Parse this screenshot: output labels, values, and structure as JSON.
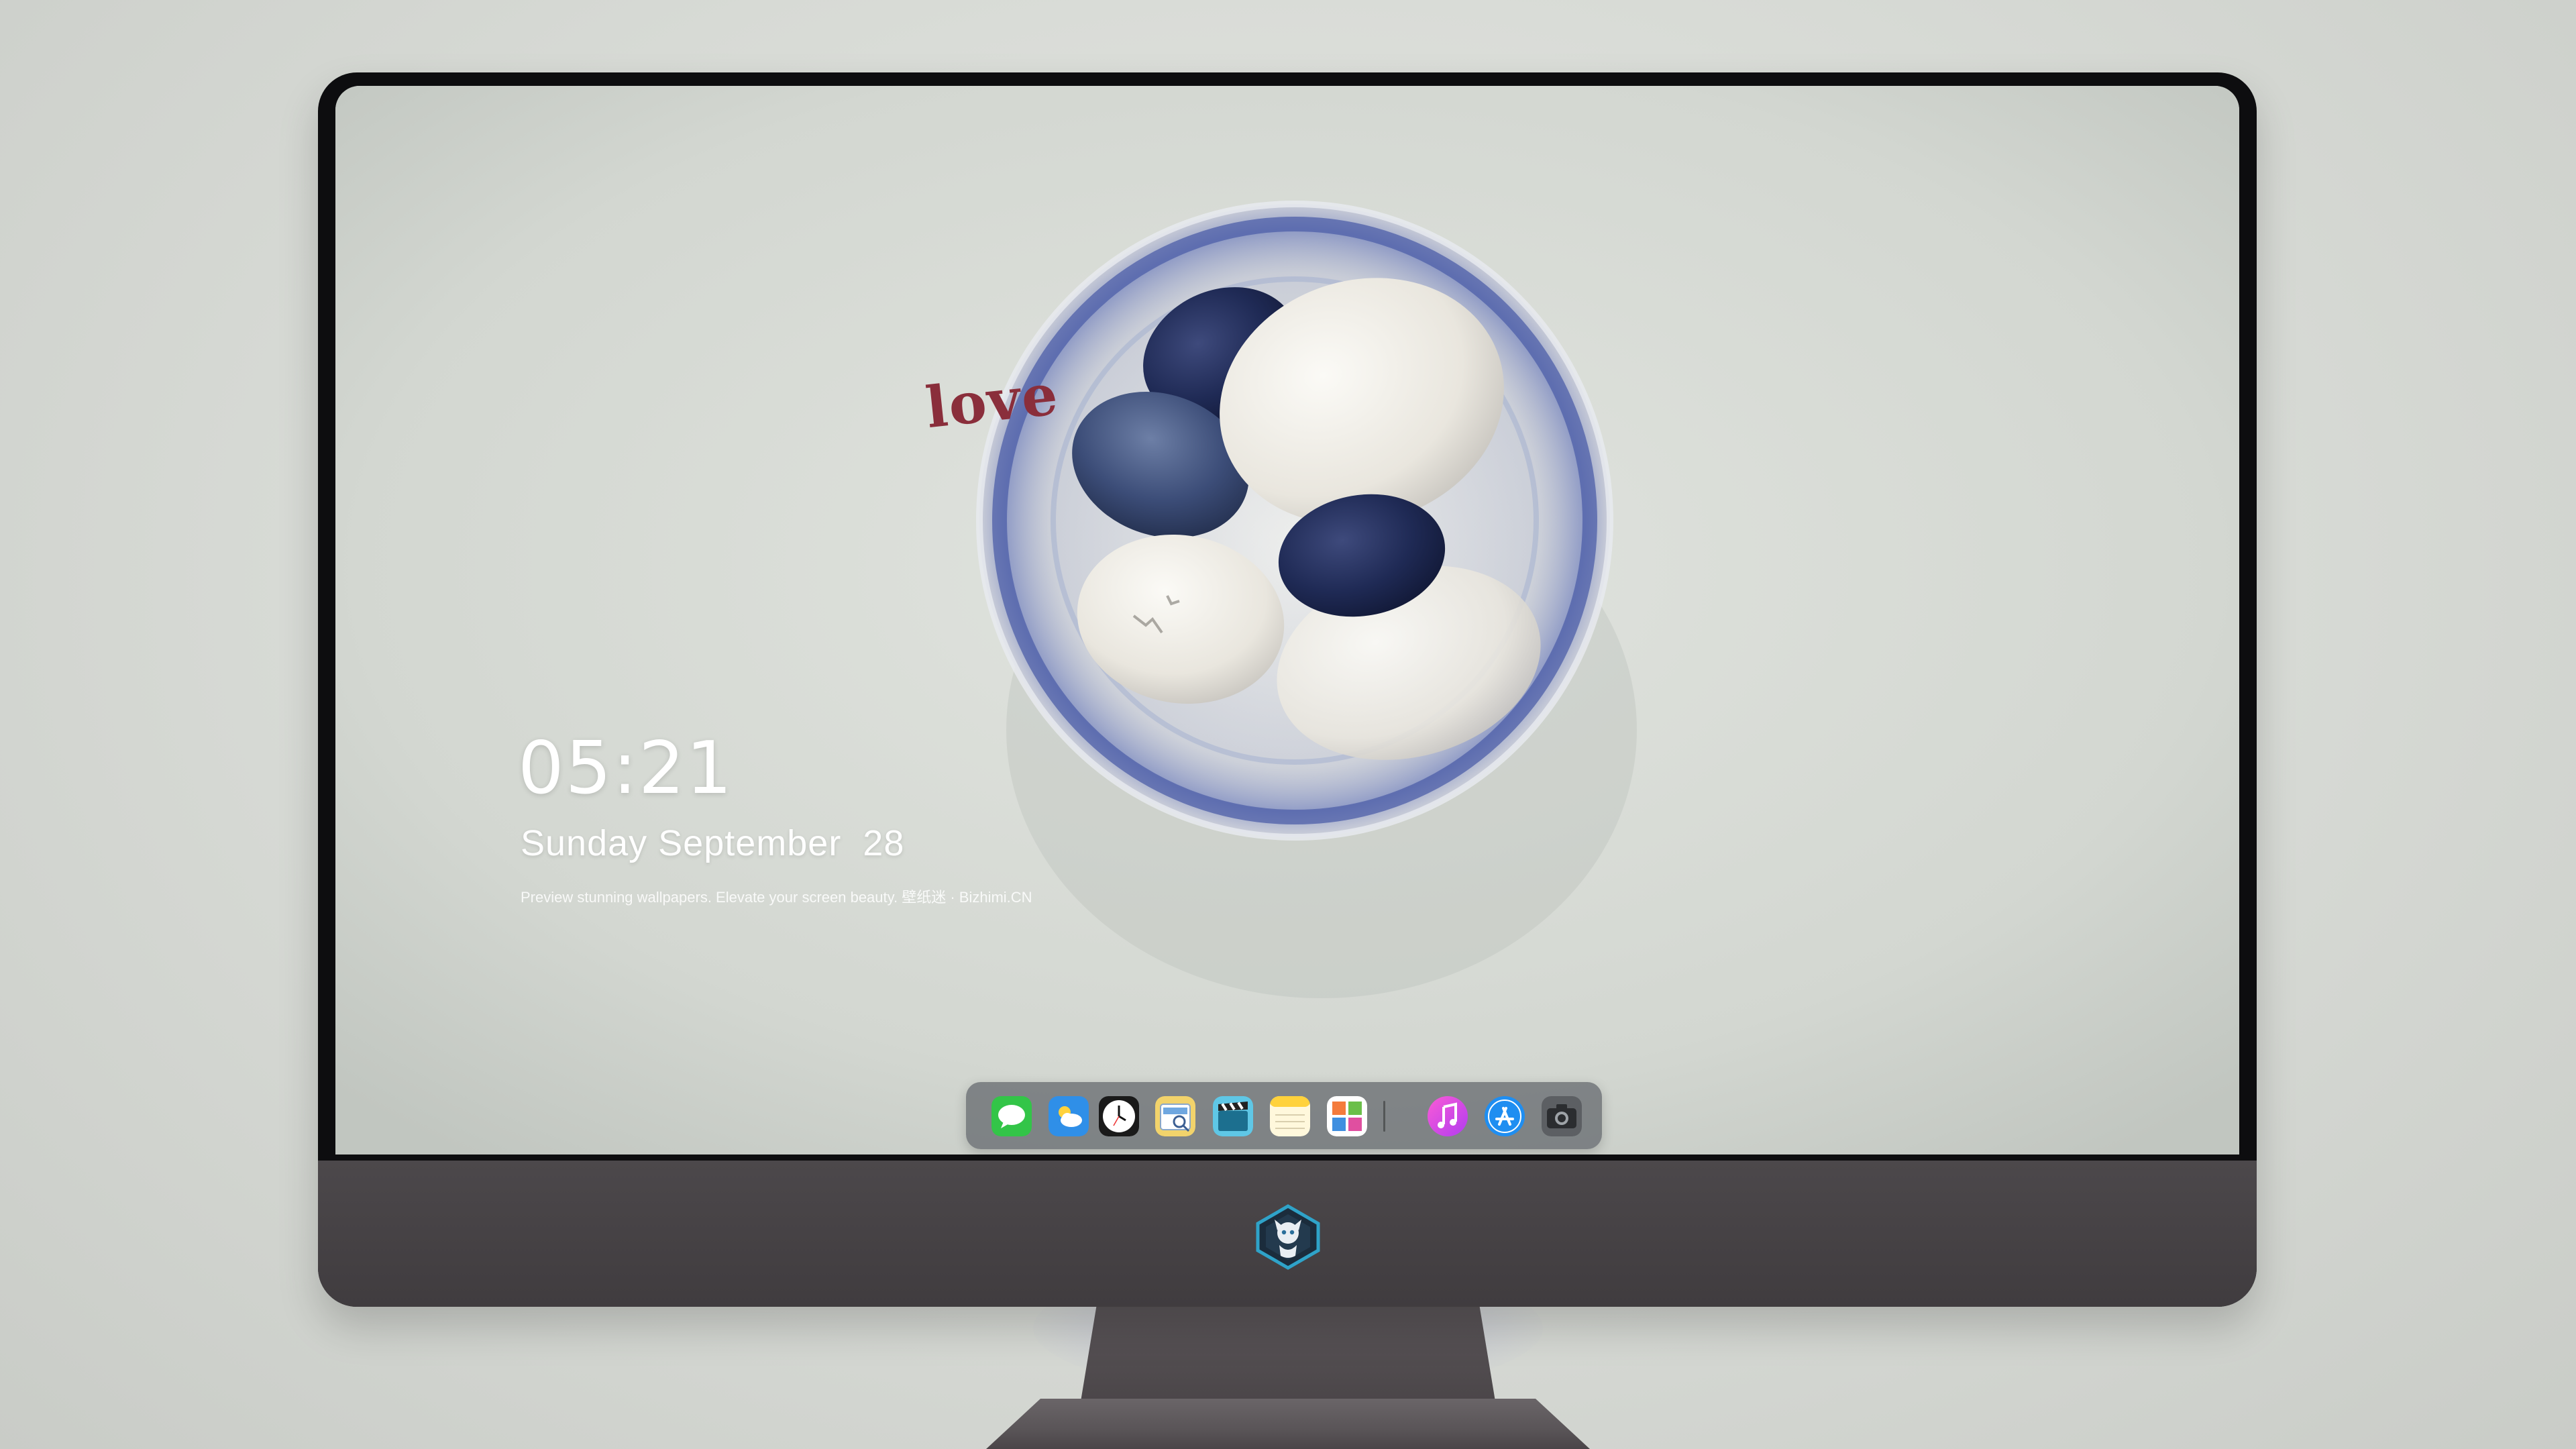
{
  "lockscreen": {
    "time": "05:21",
    "date": "Sunday September  28",
    "tagline": "Preview stunning wallpapers. Elevate your screen beauty. 壁纸迷 · Bizhimi.CN"
  },
  "wallpaper": {
    "stone_text": "love"
  },
  "dock": {
    "apps": [
      {
        "name": "messages-icon"
      },
      {
        "name": "weather-icon"
      },
      {
        "name": "clock-icon"
      },
      {
        "name": "preview-icon"
      },
      {
        "name": "video-icon"
      },
      {
        "name": "notes-icon"
      },
      {
        "name": "photo-booth-icon"
      },
      {
        "name": "music-icon"
      },
      {
        "name": "app-store-icon"
      },
      {
        "name": "camera-icon"
      }
    ]
  },
  "colors": {
    "accent": "#4a5aa8",
    "dock_background": "#5f6469",
    "bezel": "#0d0d0f",
    "chin": "#454144"
  }
}
